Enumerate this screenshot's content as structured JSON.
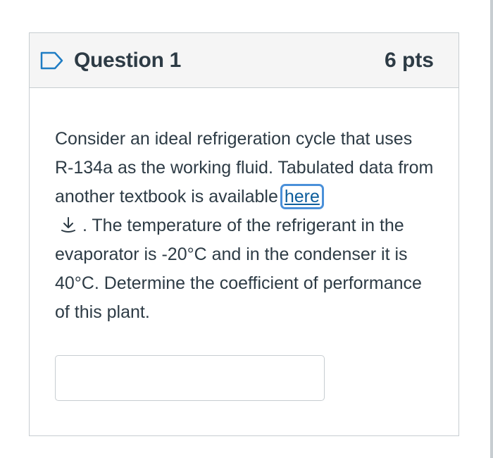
{
  "question": {
    "title": "Question 1",
    "points": "6 pts",
    "flag_icon": "flag-outline-icon",
    "text_before_link": "Consider an ideal refrigeration cycle that uses R-134a as the working fluid. Tabulated data from another textbook is available ",
    "link_text": "here",
    "download_icon": "download-arrow-icon",
    "text_after_link": ". The temperature of the refrigerant in the evaporator is -20°C and in the condenser it is 40°C. Determine the coefficient of performance of this plant."
  },
  "answer": {
    "value": "",
    "placeholder": ""
  },
  "colors": {
    "header_bg": "#f5f5f5",
    "border": "#c7cdd1",
    "text": "#2d3b45",
    "link": "#0c5d9c",
    "focus_ring": "#4a90d9"
  }
}
